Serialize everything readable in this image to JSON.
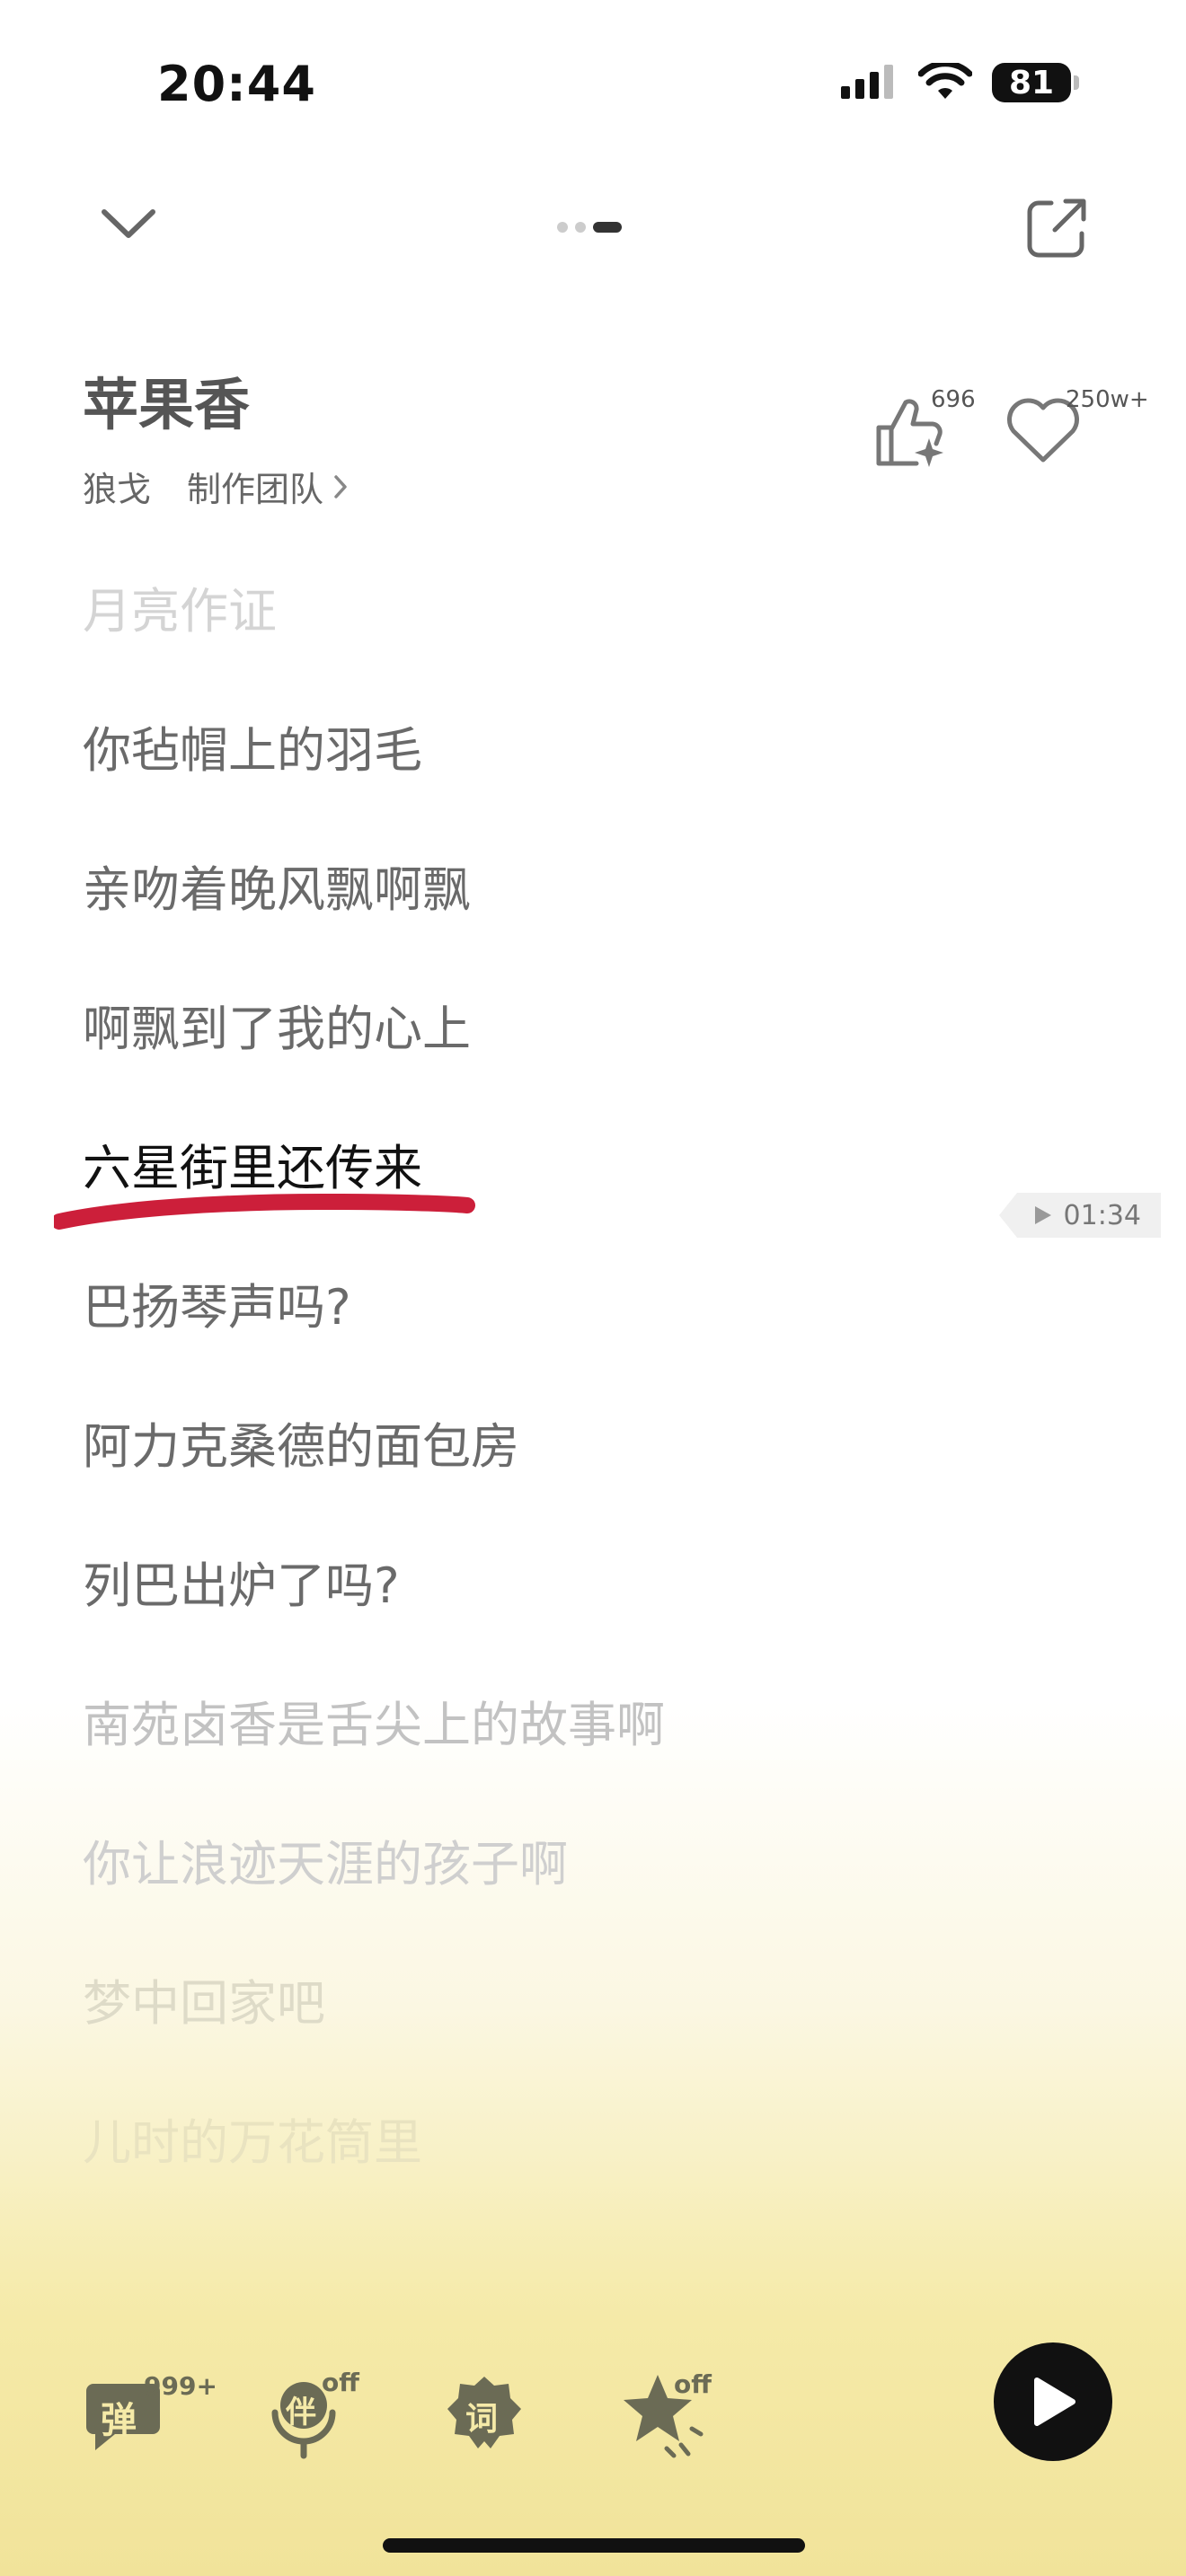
{
  "status_bar": {
    "time": "20:44",
    "battery": "81"
  },
  "song": {
    "title": "苹果香",
    "artist": "狼戈",
    "team_label": "制作团队",
    "like_count": "696",
    "fav_count": "250w+"
  },
  "lyrics": [
    {
      "text": "月亮作证",
      "color": "#d4d4d4"
    },
    {
      "text": "你毡帽上的羽毛",
      "color": "#6a6a6a"
    },
    {
      "text": "亲吻着晚风飘啊飘",
      "color": "#6a6a6a"
    },
    {
      "text": "啊飘到了我的心上",
      "color": "#6a6a6a"
    },
    {
      "text": "六星街里还传来",
      "color": "#111111"
    },
    {
      "text": "巴扬琴声吗?",
      "color": "#6a6a6a"
    },
    {
      "text": "阿力克桑德的面包房",
      "color": "#6a6a6a"
    },
    {
      "text": "列巴出炉了吗?",
      "color": "#6a6a6a"
    },
    {
      "text": "南苑卤香是舌尖上的故事啊",
      "color": "#c2c2c2"
    },
    {
      "text": "你让浪迹天涯的孩子啊",
      "color": "#cfcfcf"
    },
    {
      "text": "梦中回家吧",
      "color": "#dedbc8"
    },
    {
      "text": "儿时的万花筒里",
      "color": "#e9e3c0"
    }
  ],
  "timestamp_chip": "01:34",
  "toolbar": {
    "danmaku_icon_char": "弹",
    "danmaku_badge": "999+",
    "accompany_icon_char": "伴",
    "accompany_badge": "off",
    "lyric_icon_char": "词",
    "effect_badge": "off"
  },
  "colors": {
    "underline": "#cc1f3a",
    "accent_dark": "#111111",
    "toolbar_icon": "#6b6b55"
  }
}
